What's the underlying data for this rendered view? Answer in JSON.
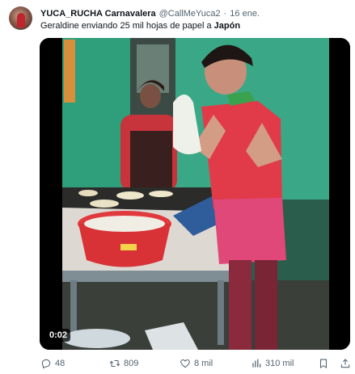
{
  "author": {
    "display_name": "YUCA_RUCHA Carnavalera",
    "handle": "@CallMeYuca2",
    "separator": "·",
    "time": "16 ene."
  },
  "tweet": {
    "text_prefix": "Geraldine enviando 25 mil hojas de papel a ",
    "text_bold": "Japón"
  },
  "media": {
    "timestamp": "0:02"
  },
  "actions": {
    "replies": "48",
    "retweets": "809",
    "likes": "8 mil",
    "views": "310 mil"
  },
  "icons": {
    "reply": "reply-icon",
    "retweet": "retweet-icon",
    "like": "heart-icon",
    "views": "views-chart-icon",
    "bookmark": "bookmark-icon",
    "share": "share-icon"
  },
  "colors": {
    "text_primary": "#0f1419",
    "text_secondary": "#536471"
  }
}
